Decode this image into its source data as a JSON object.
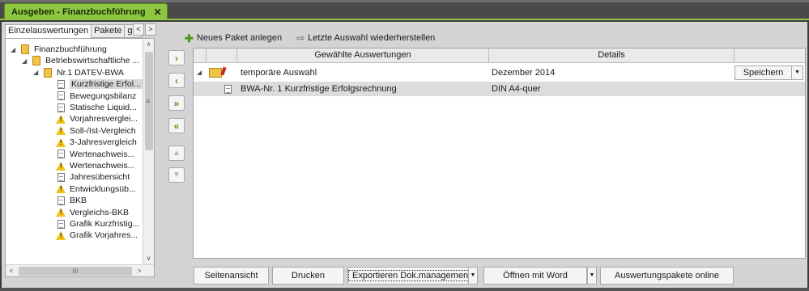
{
  "window": {
    "tab_title": "Ausgeben - Finanzbuchführung",
    "close_glyph": "✕"
  },
  "left_tabs": {
    "tabs": [
      "Einzelauswertungen",
      "Pakete",
      "geö"
    ],
    "scroll_left": "<",
    "scroll_right": ">"
  },
  "tree": {
    "items": [
      {
        "label": "Finanzbuchführung",
        "icon": "folder-icon",
        "level": 0,
        "expander": "◢"
      },
      {
        "label": "Betriebswirtschaftliche ...",
        "icon": "folder-icon",
        "level": 1,
        "expander": "◢"
      },
      {
        "label": "Nr.1 DATEV-BWA",
        "icon": "folder-icon",
        "level": 2,
        "expander": "◢"
      },
      {
        "label": "Kurzfristige Erfol...",
        "icon": "document-icon",
        "level": 3,
        "selected": true
      },
      {
        "label": "Bewegungsbilanz",
        "icon": "document-icon",
        "level": 3
      },
      {
        "label": "Statische Liquid...",
        "icon": "document-icon",
        "level": 3
      },
      {
        "label": "Vorjahresverglei...",
        "icon": "warning-icon",
        "level": 3
      },
      {
        "label": "Soll-/Ist-Vergleich",
        "icon": "warning-icon",
        "level": 3
      },
      {
        "label": "3-Jahresvergleich",
        "icon": "warning-icon",
        "level": 3
      },
      {
        "label": "Wertenachweis...",
        "icon": "document-icon",
        "level": 3
      },
      {
        "label": "Wertenachweis...",
        "icon": "warning-icon",
        "level": 3
      },
      {
        "label": "Jahresübersicht",
        "icon": "document-icon",
        "level": 3
      },
      {
        "label": "Entwicklungsüb...",
        "icon": "warning-icon",
        "level": 3
      },
      {
        "label": "BKB",
        "icon": "document-icon",
        "level": 3
      },
      {
        "label": "Vergleichs-BKB",
        "icon": "warning-icon",
        "level": 3
      },
      {
        "label": "Grafik Kurzfristig...",
        "icon": "document-icon",
        "level": 3
      },
      {
        "label": "Grafik Vorjahres...",
        "icon": "warning-icon",
        "level": 3
      }
    ]
  },
  "scrollbars": {
    "up": "∧",
    "down": "∨",
    "left": "<",
    "right": ">",
    "grip": "≡",
    "hgrip": "III"
  },
  "mid_buttons": {
    "add_one": "›",
    "remove_one": "‹",
    "add_all": "»",
    "remove_all": "«",
    "move_up": "▲",
    "move_down": "▼"
  },
  "toolbar": {
    "new_package_icon": "✚",
    "new_package": "Neues Paket anlegen",
    "restore_icon": "⇨",
    "restore": "Letzte Auswahl wiederherstellen"
  },
  "grid": {
    "columns": [
      "Gewählte Auswertungen",
      "Details"
    ],
    "rows": [
      {
        "expander": "◢",
        "name": "temporäre Auswahl",
        "details": "Dezember 2014",
        "action": "Speichern",
        "action_drop": "▼"
      },
      {
        "name": "BWA-Nr. 1 Kurzfristige Erfolgsrechnung",
        "details": "DIN A4-quer"
      }
    ]
  },
  "bottom_buttons": {
    "preview": "Seitenansicht",
    "print": "Drucken",
    "export": "Exportieren Dok.management",
    "open_word": "Öffnen mit Word",
    "online": "Auswertungspakete online",
    "drop": "▼"
  },
  "colors": {
    "accent": "#8dc641",
    "warning": "#f2c219",
    "folder": "#f0c24a"
  }
}
